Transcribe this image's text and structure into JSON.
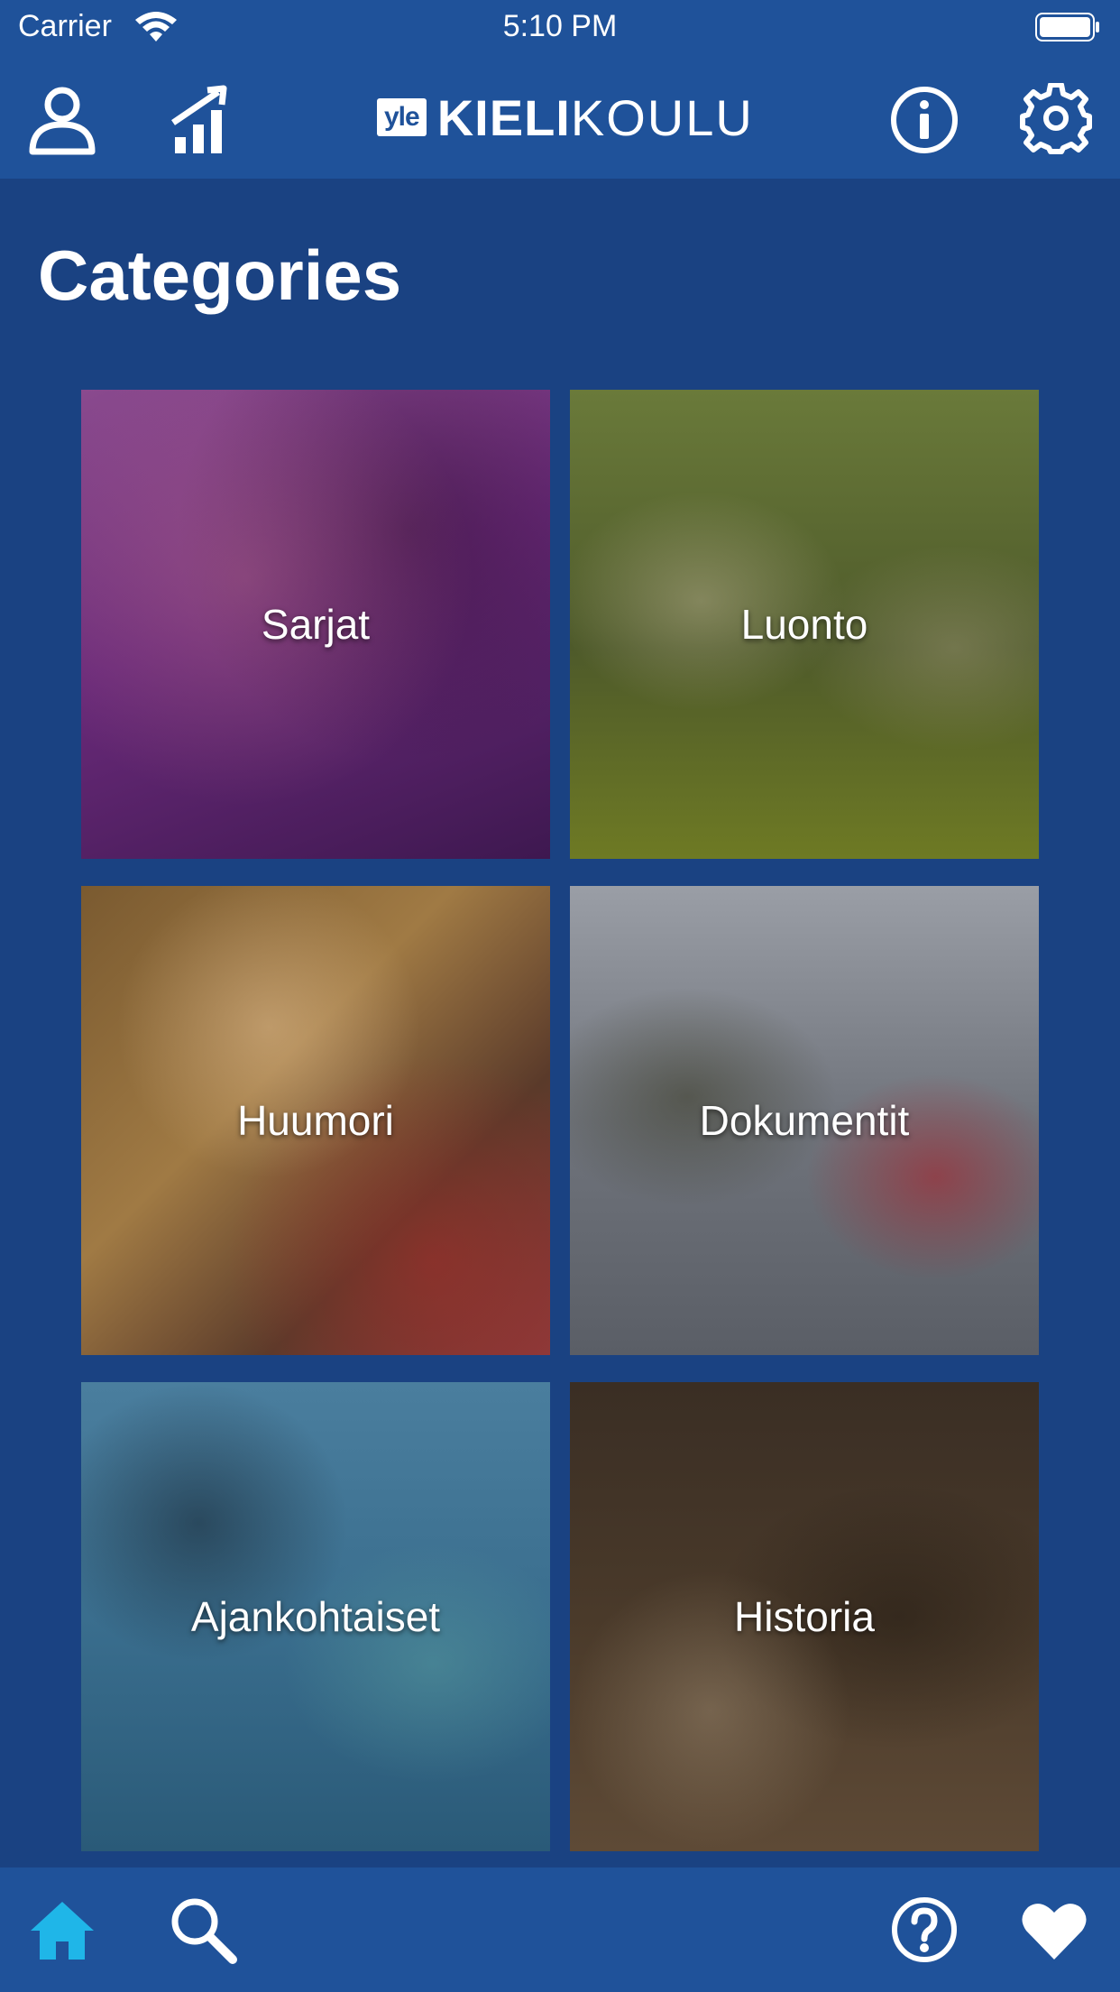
{
  "status_bar": {
    "carrier": "Carrier",
    "time": "5:10 PM"
  },
  "header": {
    "logo_prefix": "yle",
    "logo_bold": "KIELI",
    "logo_light": "KOULU",
    "icons": [
      "profile-icon",
      "stats-icon",
      "info-icon",
      "settings-icon"
    ]
  },
  "page": {
    "title": "Categories"
  },
  "categories": [
    {
      "label": "Sarjat",
      "color": "#6a2a7a"
    },
    {
      "label": "Luonto",
      "color": "#5b6a2a"
    },
    {
      "label": "Huumori",
      "color": "#8a6a30"
    },
    {
      "label": "Dokumentit",
      "color": "#707680"
    },
    {
      "label": "Ajankohtaiset",
      "color": "#3a6e8e"
    },
    {
      "label": "Historia",
      "color": "#4a3a2a"
    }
  ],
  "bottom_bar": {
    "icons": [
      "home-icon",
      "search-icon",
      "help-icon",
      "favorites-icon"
    ],
    "active_color": "#1fb6e8"
  }
}
